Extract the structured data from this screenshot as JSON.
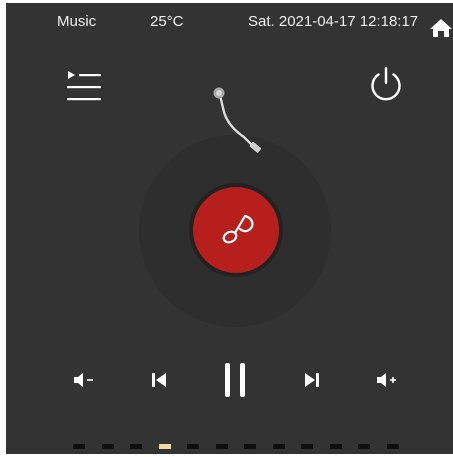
{
  "status_bar": {
    "app_name": "Music",
    "temperature": "25°C",
    "datetime": "Sat. 2021-04-17 12:18:17",
    "home_icon": "home-icon"
  },
  "top_controls": {
    "playlist_icon": "playlist-icon",
    "power_icon": "power-icon"
  },
  "player": {
    "disc_icon": "music-note-icon",
    "state": "playing",
    "controls": [
      "volume-down-icon",
      "previous-track-icon",
      "pause-icon",
      "next-track-icon",
      "volume-up-icon"
    ]
  },
  "pager": {
    "page_count": 12,
    "active_page": 4
  },
  "colors": {
    "background": "#333333",
    "disc_red": "#b71f1c",
    "active_dot": "#f2d9a2",
    "inactive_dot": "#0f0f0f",
    "foreground": "#f2f2f2"
  }
}
